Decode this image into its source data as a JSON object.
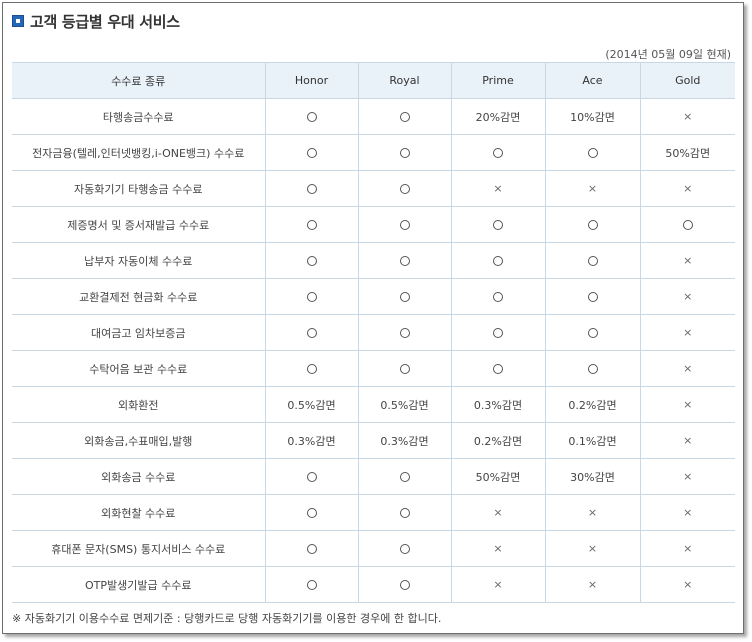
{
  "title": "고객 등급별 우대 서비스",
  "date_note": "(2014년 05월 09일 현재)",
  "table": {
    "headers": [
      "수수료 종류",
      "Honor",
      "Royal",
      "Prime",
      "Ace",
      "Gold"
    ],
    "rows": [
      {
        "name": "타행송금수수료",
        "cells": [
          "○",
          "○",
          "20%감면",
          "10%감면",
          "×"
        ]
      },
      {
        "name": "전자금융(텔레,인터넷뱅킹,i-ONE뱅크) 수수료",
        "cells": [
          "○",
          "○",
          "○",
          "○",
          "50%감면"
        ]
      },
      {
        "name": "자동화기기 타행송금 수수료",
        "cells": [
          "○",
          "○",
          "×",
          "×",
          "×"
        ]
      },
      {
        "name": "제증명서 및 증서재발급 수수료",
        "cells": [
          "○",
          "○",
          "○",
          "○",
          "○"
        ]
      },
      {
        "name": "납부자 자동이체 수수료",
        "cells": [
          "○",
          "○",
          "○",
          "○",
          "×"
        ]
      },
      {
        "name": "교환결제전 현금화 수수료",
        "cells": [
          "○",
          "○",
          "○",
          "○",
          "×"
        ]
      },
      {
        "name": "대여금고 임차보증금",
        "cells": [
          "○",
          "○",
          "○",
          "○",
          "×"
        ]
      },
      {
        "name": "수탁어음 보관 수수료",
        "cells": [
          "○",
          "○",
          "○",
          "○",
          "×"
        ]
      },
      {
        "name": "외화환전",
        "cells": [
          "0.5%감면",
          "0.5%감면",
          "0.3%감면",
          "0.2%감면",
          "×"
        ]
      },
      {
        "name": "외화송금,수표매입,발행",
        "cells": [
          "0.3%감면",
          "0.3%감면",
          "0.2%감면",
          "0.1%감면",
          "×"
        ]
      },
      {
        "name": "외화송금 수수료",
        "cells": [
          "○",
          "○",
          "50%감면",
          "30%감면",
          "×"
        ]
      },
      {
        "name": "외화현찰 수수료",
        "cells": [
          "○",
          "○",
          "×",
          "×",
          "×"
        ]
      },
      {
        "name": "휴대폰 문자(SMS) 통지서비스 수수료",
        "cells": [
          "○",
          "○",
          "×",
          "×",
          "×"
        ]
      },
      {
        "name": "OTP발생기발급 수수료",
        "cells": [
          "○",
          "○",
          "×",
          "×",
          "×"
        ]
      }
    ]
  },
  "footnote": "※ 자동화기기 이용수수료 면제기준 : 당행카드로 당행 자동화기기를 이용한 경우에 한 합니다.",
  "colors": {
    "header_bg": "#e9f1f9",
    "border": "#c9d6e3",
    "icon": "#2566b8"
  },
  "icons": {
    "title": "square-bullet-icon",
    "yes": "circle-icon",
    "no": "cross-icon"
  }
}
